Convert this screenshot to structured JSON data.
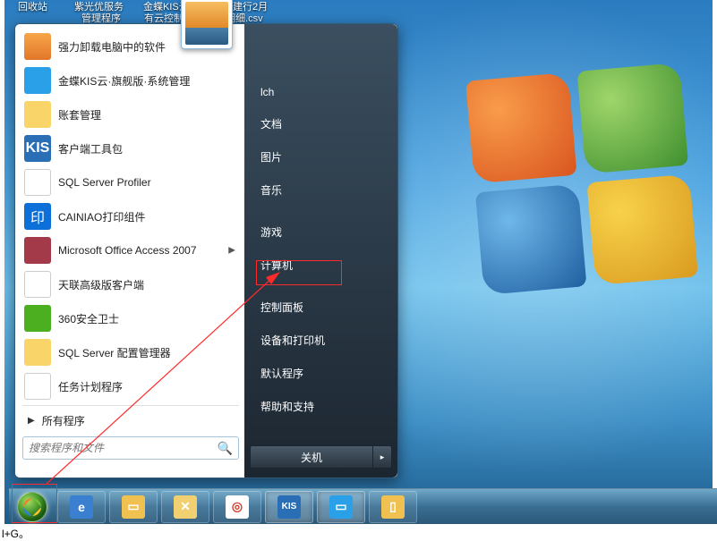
{
  "desktop_icons": {
    "recycle": "回收站",
    "i2": "紫光优服务",
    "i3": "金蝶KIS云·私",
    "i4": "安速建行2月",
    "i5": "管理程序",
    "i6": "有云控制台",
    "i7": "1-28明细.csv"
  },
  "start_menu": {
    "programs": [
      {
        "label": "强力卸载电脑中的软件",
        "icon": "ic-uninstall",
        "name": "program-uninstall"
      },
      {
        "label": "金蝶KIS云·旗舰版·系统管理",
        "icon": "ic-kis-cloud",
        "name": "program-kis-cloud"
      },
      {
        "label": "账套管理",
        "icon": "ic-folder",
        "name": "program-account-mgmt"
      },
      {
        "label": "客户端工具包",
        "icon": "ic-kis",
        "name": "program-client-tools",
        "icon_text": "KIS"
      },
      {
        "label": "SQL Server Profiler",
        "icon": "ic-sql",
        "name": "program-sql-profiler",
        "icon_text": "▤"
      },
      {
        "label": "CAINIAO打印组件",
        "icon": "ic-cainiao",
        "name": "program-cainiao",
        "icon_text": "印"
      },
      {
        "label": "Microsoft Office Access 2007",
        "icon": "ic-access",
        "name": "program-access",
        "has_arrow": true
      },
      {
        "label": "天联高级版客户端",
        "icon": "ic-tian",
        "name": "program-tianlian"
      },
      {
        "label": "360安全卫士",
        "icon": "ic-360",
        "name": "program-360"
      },
      {
        "label": "SQL Server 配置管理器",
        "icon": "ic-sqlcfg",
        "name": "program-sql-config"
      },
      {
        "label": "任务计划程序",
        "icon": "ic-task",
        "name": "program-task-sched",
        "icon_text": "◷"
      }
    ],
    "all_programs": "所有程序",
    "search_placeholder": "搜索程序和文件",
    "right": {
      "user": "lch",
      "items": [
        "文档",
        "图片",
        "音乐"
      ],
      "items2": [
        "游戏",
        "计算机"
      ],
      "items3": [
        "控制面板",
        "设备和打印机",
        "默认程序",
        "帮助和支持"
      ],
      "shutdown": "关机"
    }
  },
  "taskbar": [
    {
      "name": "taskbar-ie",
      "bg": "#3a7fd0",
      "glyph": "e"
    },
    {
      "name": "taskbar-explorer",
      "bg": "#f0c050",
      "glyph": "▭"
    },
    {
      "name": "taskbar-tools",
      "bg": "#f0d070",
      "glyph": "✕"
    },
    {
      "name": "taskbar-chrome",
      "bg": "#fff",
      "glyph": "◎"
    },
    {
      "name": "taskbar-kis",
      "bg": "#2a6fb5",
      "glyph": "KIS",
      "active": true
    },
    {
      "name": "taskbar-kis-cloud",
      "bg": "#2aa0e8",
      "glyph": "▭",
      "active": true
    },
    {
      "name": "taskbar-sql",
      "bg": "#f0c050",
      "glyph": "▯"
    }
  ],
  "bottom_label": "l+G。"
}
